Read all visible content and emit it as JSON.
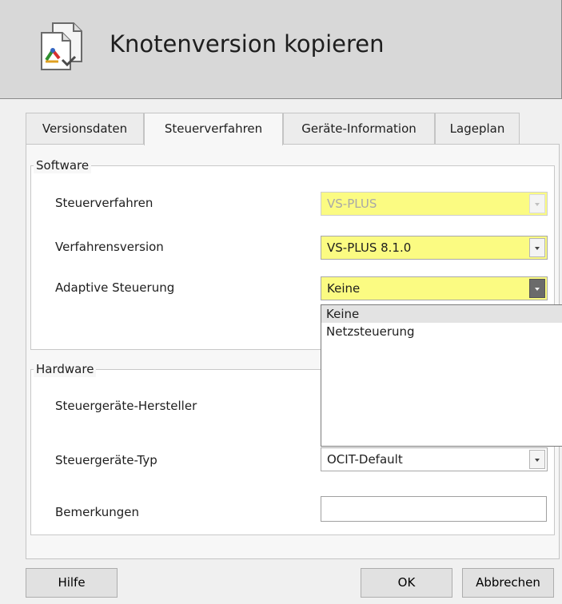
{
  "dialog": {
    "title": "Knotenversion kopieren",
    "icon": "copy-node-version-icon"
  },
  "tabs": [
    {
      "label": "Versionsdaten",
      "active": false
    },
    {
      "label": "Steuerverfahren",
      "active": true
    },
    {
      "label": "Geräte-Information",
      "active": false
    },
    {
      "label": "Lageplan",
      "active": false
    }
  ],
  "software": {
    "legend": "Software",
    "steuerverfahren": {
      "label": "Steuerverfahren",
      "value": "VS-PLUS",
      "enabled": false
    },
    "verfahrensversion": {
      "label": "Verfahrensversion",
      "value": "VS-PLUS 8.1.0"
    },
    "adaptive": {
      "label": "Adaptive Steuerung",
      "value": "Keine"
    }
  },
  "dropdown": {
    "open": true,
    "options": [
      "Keine",
      "Netzsteuerung"
    ],
    "selected": "Keine"
  },
  "hardware": {
    "legend": "Hardware",
    "hersteller": {
      "label": "Steuergeräte-Hersteller",
      "value": ""
    },
    "typ": {
      "label": "Steuergeräte-Typ",
      "value": "OCIT-Default"
    },
    "bemerkungen": {
      "label": "Bemerkungen",
      "value": ""
    }
  },
  "buttons": {
    "help": "Hilfe",
    "ok": "OK",
    "cancel": "Abbrechen"
  },
  "colors": {
    "required_field": "#fbfb82",
    "header_bg": "#d8d8d8",
    "window_bg": "#f0f0f0"
  }
}
